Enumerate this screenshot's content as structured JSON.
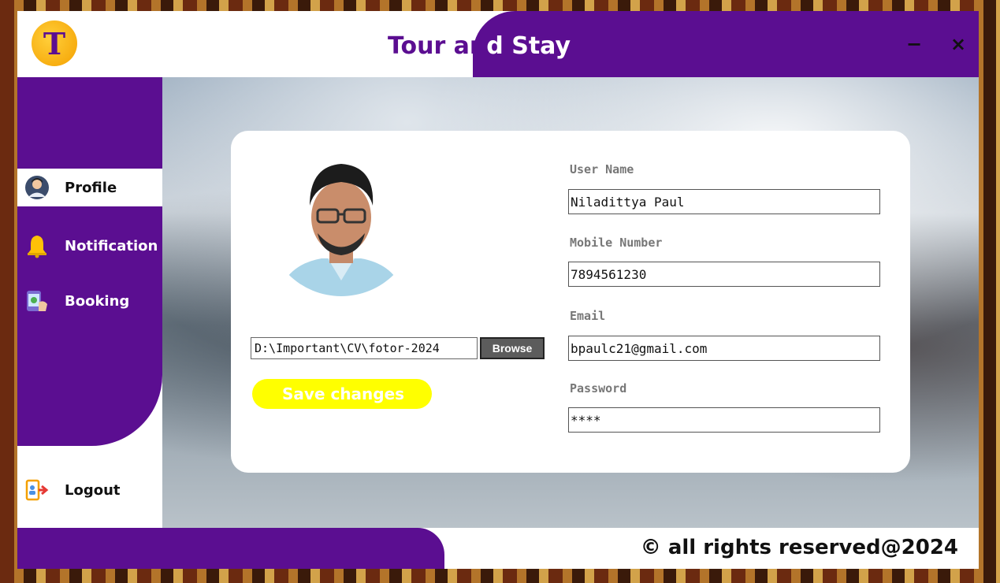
{
  "app": {
    "title_part1": "Tour an",
    "title_part2": "d Stay",
    "logo_letter": "T"
  },
  "window_controls": {
    "minimize": "−",
    "close": "×"
  },
  "sidebar": {
    "items": [
      {
        "label": "Profile",
        "icon": "user-avatar-icon",
        "active": true
      },
      {
        "label": "Notification",
        "icon": "bell-icon",
        "active": false
      },
      {
        "label": "Booking",
        "icon": "booking-icon",
        "active": false
      }
    ],
    "logout": {
      "label": "Logout",
      "icon": "logout-icon"
    }
  },
  "profile": {
    "photo_path": "D:\\Important\\CV\\fotor-2024",
    "browse_label": "Browse",
    "save_label": "Save changes"
  },
  "fields": {
    "username": {
      "label": "User Name",
      "value": "Niladittya Paul"
    },
    "mobile": {
      "label": "Mobile Number",
      "value": "7894561230"
    },
    "email": {
      "label": "Email",
      "value": "bpaulc21@gmail.com"
    },
    "password": {
      "label": "Password",
      "value": "****"
    }
  },
  "footer": {
    "copyright": "© all rights reserved@2024"
  },
  "colors": {
    "brand_purple": "#5b0e91",
    "accent_yellow": "#ffff00",
    "logo_orange": "#f4a000"
  }
}
